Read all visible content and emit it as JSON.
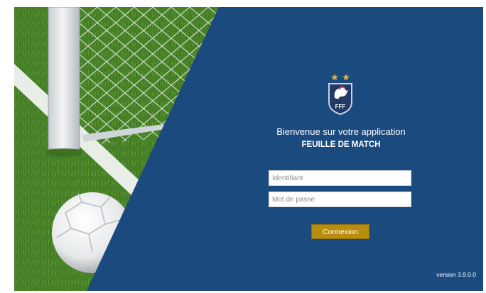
{
  "login": {
    "welcome": "Bienvenue sur votre application",
    "app_name": "FEUILLE DE MATCH",
    "username_placeholder": "Identifiant",
    "password_placeholder": "Mot de passe",
    "connect_label": "Connexion",
    "version": "version 3.9.0.0"
  },
  "logo": {
    "text": "FFF",
    "stars": 2
  },
  "colors": {
    "panel_blue": "#1b4a7f",
    "button_gold": "#b98e10",
    "grass": "#4c8a2a"
  }
}
